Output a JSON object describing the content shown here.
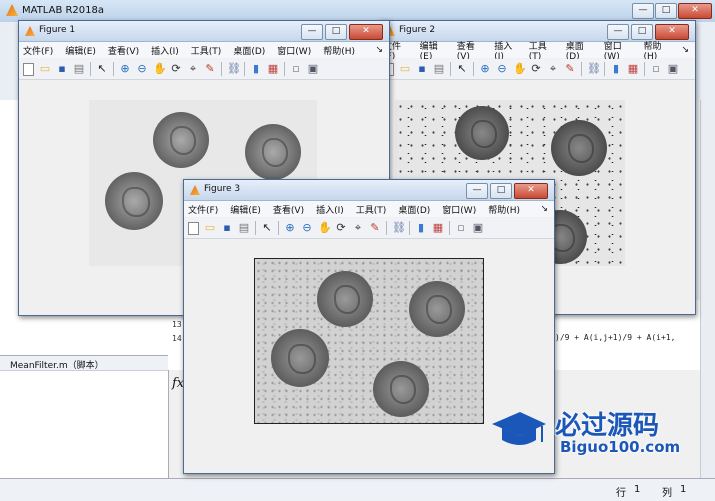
{
  "main_window": {
    "title": "MATLAB R2018a",
    "min_label": "—",
    "max_label": "□",
    "close_label": "✕",
    "editor_file_tab": "MeanFilter.m（脚本）",
    "fx_label": "fx",
    "code_lines": [
      "13",
      "14"
    ],
    "code_snippet": ")/9 + A(i,j+1)/9 + A(i+1,",
    "status": {
      "row_label": "行",
      "row_value": "1",
      "col_label": "列",
      "col_value": "1"
    }
  },
  "figure_menu": [
    "文件(F)",
    "编辑(E)",
    "查看(V)",
    "插入(I)",
    "工具(T)",
    "桌面(D)",
    "窗口(W)",
    "帮助(H)"
  ],
  "figure_menu_arrow": "↘",
  "toolbar_icons": [
    "new-figure-icon",
    "open-file-icon",
    "save-icon",
    "print-icon",
    "sep",
    "select-arrow-icon",
    "sep",
    "zoom-in-icon",
    "zoom-out-icon",
    "pan-hand-icon",
    "rotate-3d-icon",
    "data-cursor-icon",
    "brush-icon",
    "sep",
    "link-plot-icon",
    "sep",
    "colorbar-icon",
    "legend-icon",
    "sep",
    "hide-plot-tools-icon",
    "show-plot-tools-icon"
  ],
  "figures": [
    {
      "title": "Figure 1"
    },
    {
      "title": "Figure 2"
    },
    {
      "title": "Figure 3"
    }
  ],
  "watermark": {
    "title": "必过源码",
    "subtitle": "Biguo100.com"
  },
  "colors": {
    "accent": "#1a57b8",
    "title_bar": "#c6d7ec",
    "close_red": "#c84a34"
  }
}
